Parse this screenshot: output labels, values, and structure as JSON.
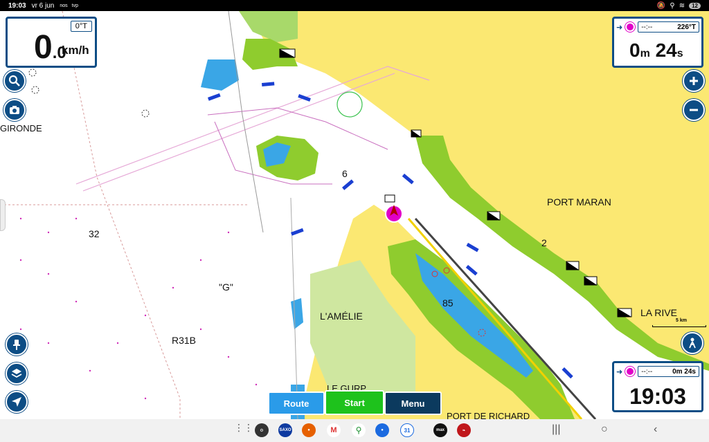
{
  "status_bar": {
    "time": "19:03",
    "date": "vr 6 jun",
    "extra1": "nos",
    "extra2": "tvp",
    "battery": "12"
  },
  "speed_panel": {
    "heading": "0°T",
    "speed_value": "0.0",
    "speed_int": "0",
    "speed_dec": ".0",
    "speed_unit": "km/h"
  },
  "nav_panel": {
    "dist": "--:--",
    "bearing": "226°T",
    "eta_m": "0",
    "eta_m_unit": "m",
    "eta_s": "24",
    "eta_s_unit": "s"
  },
  "clock_panel": {
    "dist": "--:--",
    "eta": "0m 24s",
    "clock": "19:03"
  },
  "map_labels": {
    "gironde": "GIRONDE",
    "port_maran": "PORT MARAN",
    "la_rive": "LA RIVE",
    "lamelie": "L'AMÉLIE",
    "le_gurp": "LE GURP",
    "port_de_richard": "PORT DE RICHARD",
    "r31b": "R31B",
    "g": "\"G\"",
    "depth_32": "32",
    "depth_6": "6",
    "depth_2": "2",
    "depth_85": "85"
  },
  "scale": {
    "label": "5 km"
  },
  "buttons": {
    "route": "Route",
    "start": "Start",
    "menu": "Menu"
  },
  "icons": {
    "search": "search-icon",
    "camera": "camera-icon",
    "zoom_in": "plus-icon",
    "zoom_out": "minus-icon",
    "pin": "pin-icon",
    "layers": "layers-icon",
    "locate": "navigation-arrow-icon",
    "person": "person-mode-icon"
  },
  "colors": {
    "panel_border": "#0d4d85",
    "land": "#fbe872",
    "marsh": "#8fcc2e",
    "shallow": "#3aa6e6",
    "route_btn": "#2a9be9",
    "start_btn": "#1ec21c",
    "menu_btn": "#0b3a5e",
    "waypoint": "#e100c8"
  }
}
